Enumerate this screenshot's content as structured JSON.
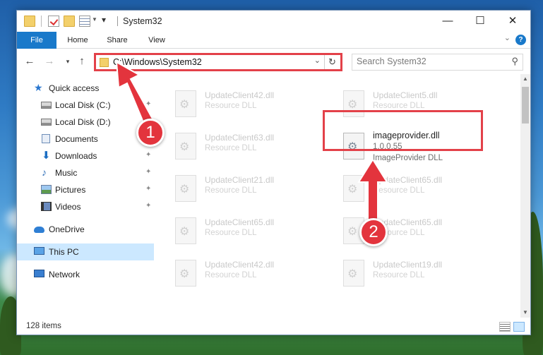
{
  "window": {
    "title": "System32",
    "controls": {
      "minimize": "—",
      "maximize": "☐",
      "close": "✕"
    }
  },
  "ribbon": {
    "tabs": [
      "File",
      "Home",
      "Share",
      "View"
    ],
    "help": "?"
  },
  "nav": {
    "address": "C:\\Windows\\System32",
    "search_placeholder": "Search System32"
  },
  "sidebar": {
    "items": [
      {
        "label": "Quick access",
        "icon": "star-icon",
        "pinned": false
      },
      {
        "label": "Local Disk (C:)",
        "icon": "drive-icon",
        "pinned": true
      },
      {
        "label": "Local Disk (D:)",
        "icon": "drive-icon",
        "pinned": true
      },
      {
        "label": "Documents",
        "icon": "documents-icon",
        "pinned": true
      },
      {
        "label": "Downloads",
        "icon": "downloads-icon",
        "pinned": true
      },
      {
        "label": "Music",
        "icon": "music-icon",
        "pinned": true
      },
      {
        "label": "Pictures",
        "icon": "pictures-icon",
        "pinned": true
      },
      {
        "label": "Videos",
        "icon": "videos-icon",
        "pinned": true
      },
      {
        "label": "OneDrive",
        "icon": "onedrive-icon",
        "pinned": false
      },
      {
        "label": "This PC",
        "icon": "this-pc-icon",
        "pinned": false,
        "selected": true
      },
      {
        "label": "Network",
        "icon": "network-icon",
        "pinned": false
      }
    ]
  },
  "files": [
    {
      "name": "UpdateClient42.dll",
      "desc": "Resource DLL"
    },
    {
      "name": "UpdateClient5.dll",
      "desc": "Resource DLL"
    },
    {
      "name": "UpdateClient63.dll",
      "desc": "Resource DLL"
    },
    {
      "name": "imageprovider.dll",
      "version": "1.0.0.55",
      "desc": "ImageProvider DLL",
      "highlighted": true
    },
    {
      "name": "UpdateClient21.dll",
      "desc": "Resource DLL"
    },
    {
      "name": "UpdateClient65.dll",
      "desc": "Resource DLL"
    },
    {
      "name": "UpdateClient65.dll",
      "desc": "Resource DLL"
    },
    {
      "name": "UpdateClient65.dll",
      "desc": "Resource DLL"
    },
    {
      "name": "UpdateClient42.dll",
      "desc": "Resource DLL"
    },
    {
      "name": "UpdateClient19.dll",
      "desc": "Resource DLL"
    }
  ],
  "status": {
    "count": "128 items"
  },
  "callouts": [
    "1",
    "2"
  ],
  "colors": {
    "accent": "#1979ca",
    "highlight": "#e34149",
    "selected": "#cce8ff"
  }
}
